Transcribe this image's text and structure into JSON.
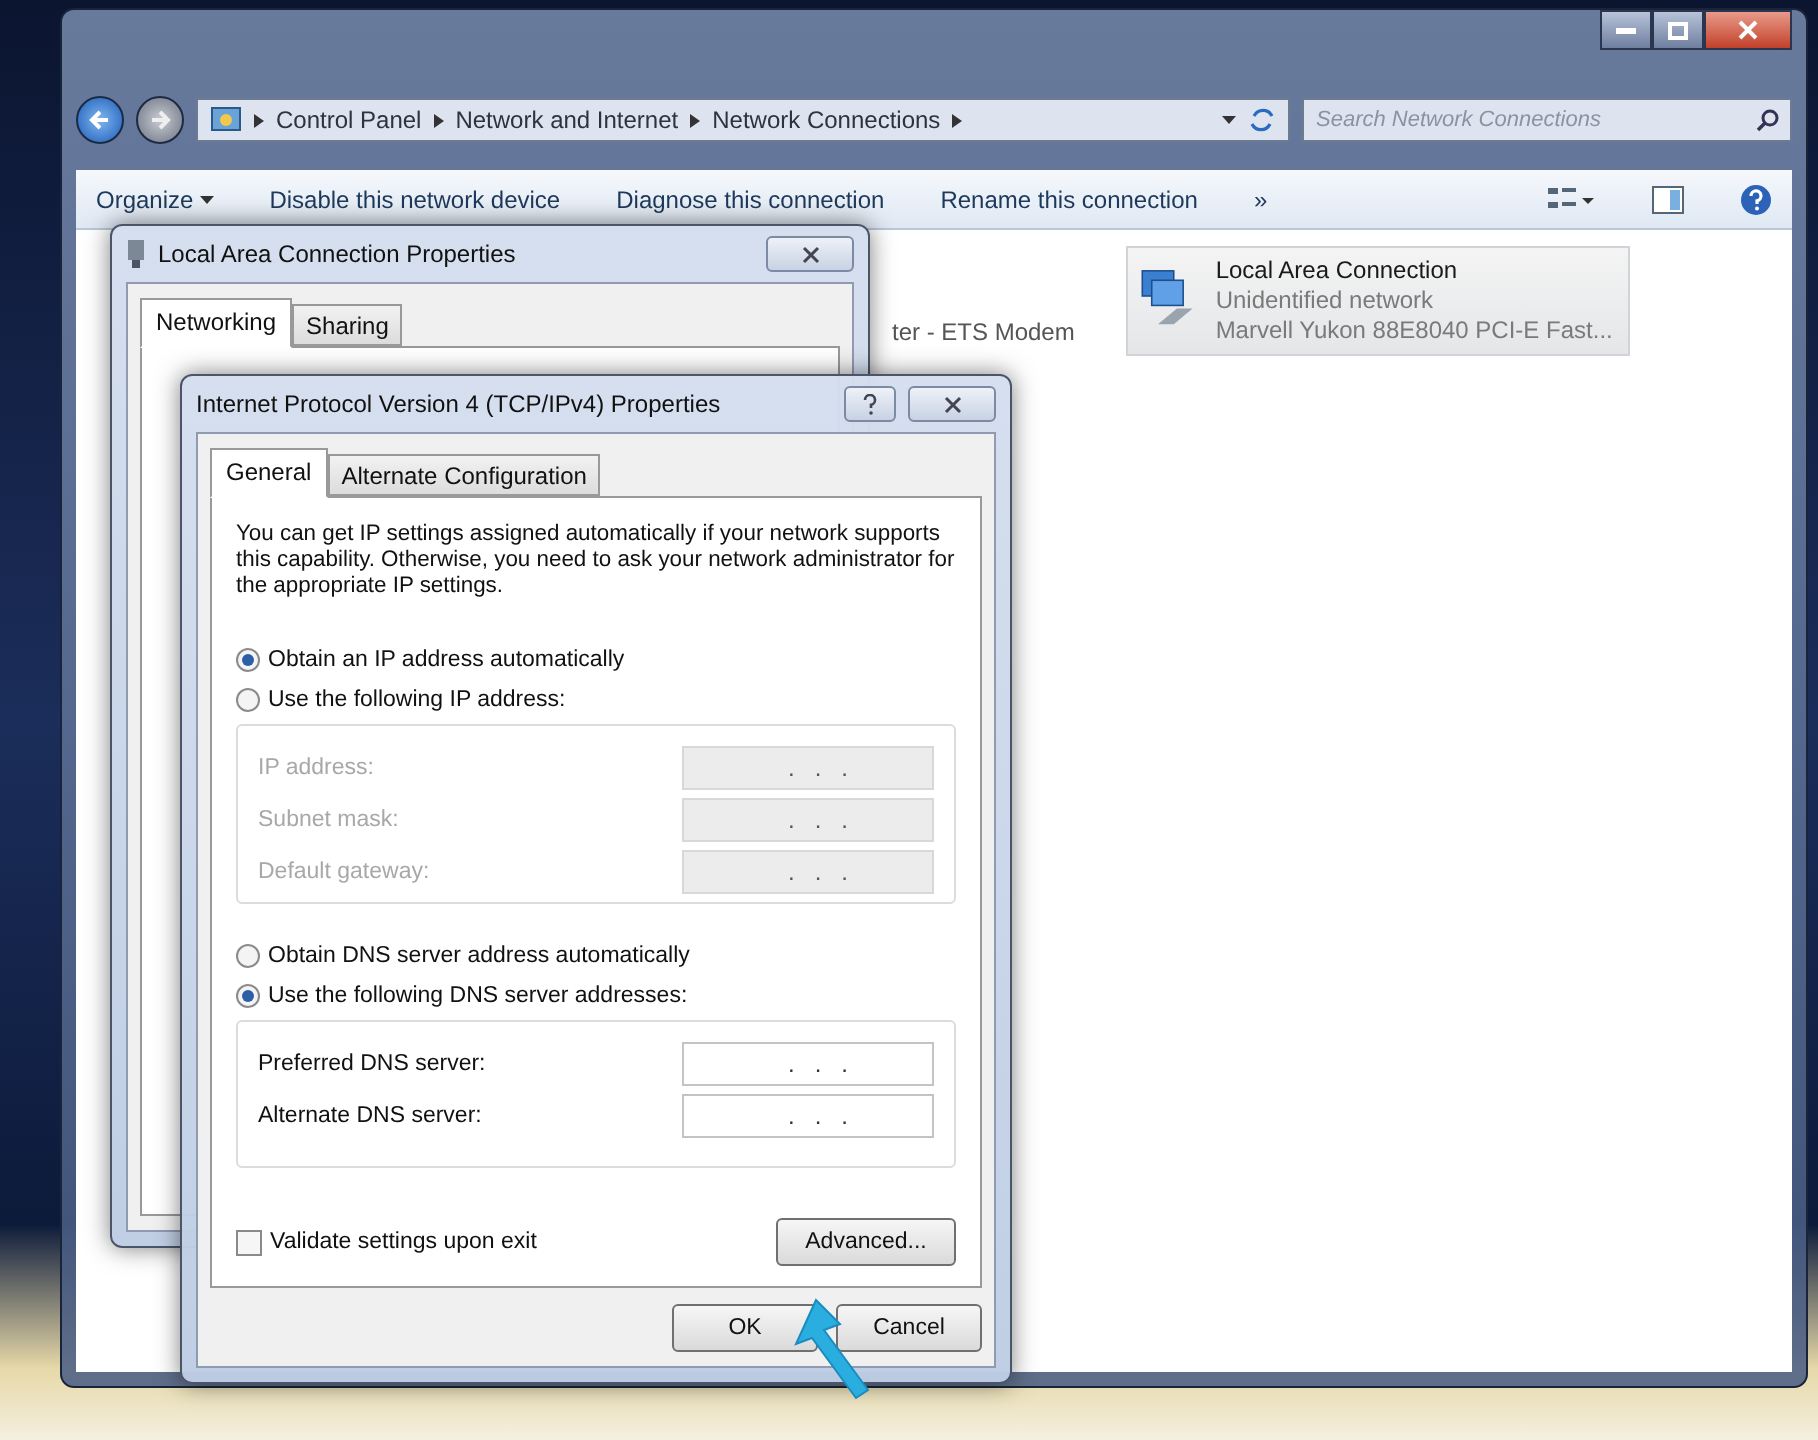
{
  "explorer": {
    "address": {
      "path": [
        "Control Panel",
        "Network and Internet",
        "Network Connections"
      ]
    },
    "search": {
      "placeholder": "Search Network Connections"
    },
    "toolbar": [
      {
        "label": "Organize",
        "dropdown": true
      },
      {
        "label": "Disable this network device",
        "dropdown": false
      },
      {
        "label": "Diagnose this connection",
        "dropdown": false
      },
      {
        "label": "Rename this connection",
        "dropdown": false
      }
    ],
    "overflow": "»",
    "partial_text": "ter - ETS Modem",
    "connections": [
      {
        "name": "Local Area Connection",
        "status": "Unidentified network",
        "device": "Marvell Yukon 88E8040 PCI-E Fast..."
      }
    ]
  },
  "lan_dialog": {
    "title": "Local Area Connection Properties",
    "tabs": [
      {
        "label": "Networking",
        "selected": true
      },
      {
        "label": "Sharing",
        "selected": false
      }
    ]
  },
  "ipv4_dialog": {
    "title": "Internet Protocol Version 4 (TCP/IPv4) Properties",
    "tabs": [
      {
        "label": "General",
        "selected": true
      },
      {
        "label": "Alternate Configuration",
        "selected": false
      }
    ],
    "intro": "You can get IP settings assigned automatically if your network supports this capability. Otherwise, you need to ask your network administrator for the appropriate IP settings.",
    "ip_mode": [
      {
        "label": "Obtain an IP address automatically",
        "selected": true
      },
      {
        "label": "Use the following IP address:",
        "selected": false
      }
    ],
    "ip_fields": [
      {
        "label": "IP address:",
        "value": ".   .   .",
        "disabled": true
      },
      {
        "label": "Subnet mask:",
        "value": ".   .   .",
        "disabled": true
      },
      {
        "label": "Default gateway:",
        "value": ".   .   .",
        "disabled": true
      }
    ],
    "dns_mode": [
      {
        "label": "Obtain DNS server address automatically",
        "selected": false
      },
      {
        "label": "Use the following DNS server addresses:",
        "selected": true
      }
    ],
    "dns_fields": [
      {
        "label": "Preferred DNS server:",
        "value": ".   .   .",
        "disabled": false
      },
      {
        "label": "Alternate DNS server:",
        "value": ".   .   .",
        "disabled": false
      }
    ],
    "validate": {
      "label": "Validate settings upon exit",
      "checked": false
    },
    "advanced": "Advanced...",
    "buttons": [
      "OK",
      "Cancel"
    ]
  }
}
